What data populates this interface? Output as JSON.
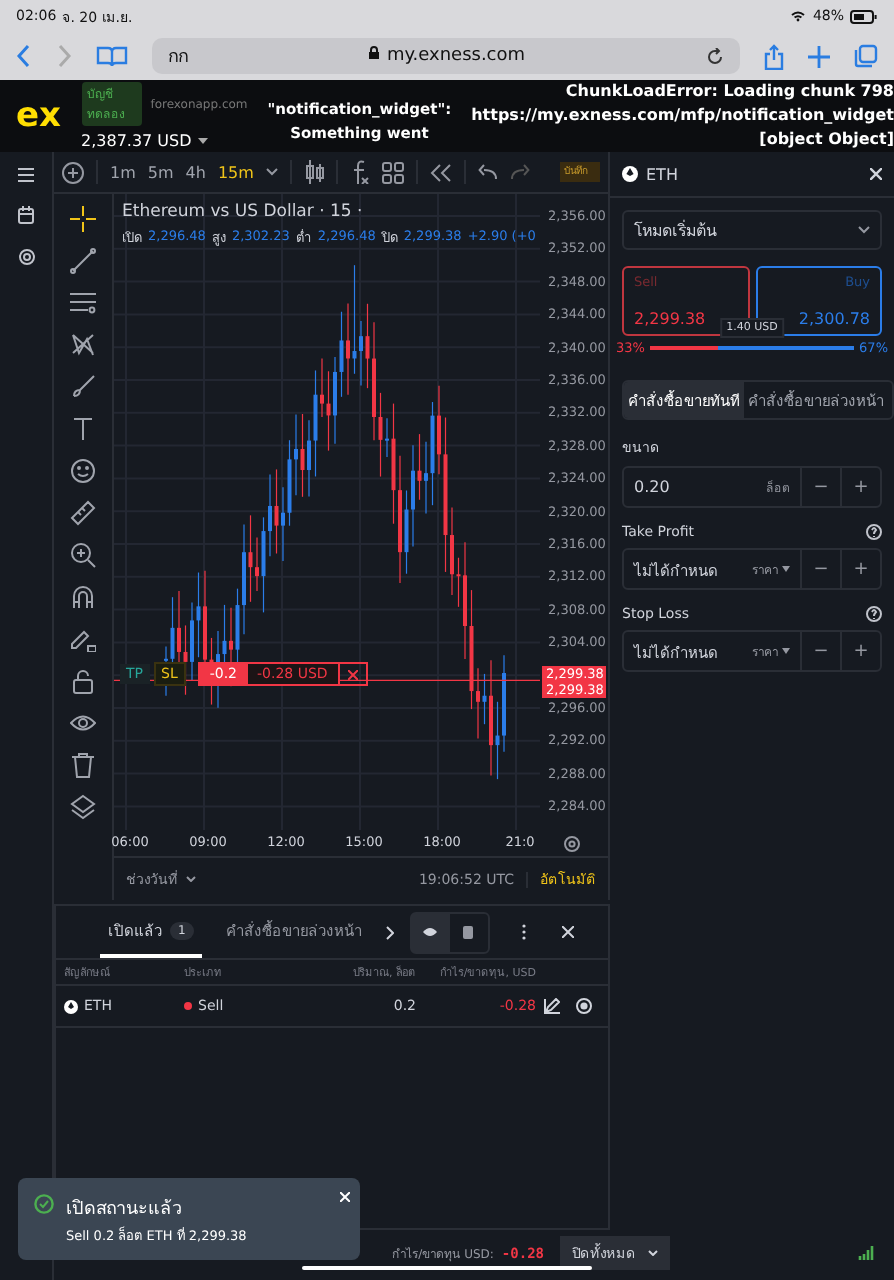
{
  "status_bar": {
    "time": "02:06",
    "date": "จ. 20 เม.ย.",
    "battery": "48%"
  },
  "browser": {
    "tab_text": "กก",
    "url": "my.exness.com"
  },
  "header": {
    "logo": "ex",
    "account_badge": "บัญชีทดลอง",
    "account_server": "forexonapp.com",
    "balance": "2,387.37 USD",
    "error_center": [
      "\"notification_widget\":",
      "Something went"
    ],
    "error_right": [
      "ChunkLoadError: Loading chunk 798",
      "https://my.exness.com/mfp/notification_widget",
      "[object Object]"
    ]
  },
  "chart_toolbar": {
    "timeframes": [
      {
        "label": "1m",
        "selected": false
      },
      {
        "label": "5m",
        "selected": false
      },
      {
        "label": "4h",
        "selected": false
      },
      {
        "label": "15m",
        "selected": true
      }
    ],
    "save_label": "บันทึก"
  },
  "chart": {
    "title": "Ethereum vs US Dollar · 15 ·",
    "ohlc": [
      {
        "label": "เปิด",
        "value": "2,296.48"
      },
      {
        "label": "สูง",
        "value": "2,302.23"
      },
      {
        "label": "ต่ำ",
        "value": "2,296.48"
      },
      {
        "label": "ปิด",
        "value": "2,299.38"
      }
    ],
    "change": "+2.90 (+0",
    "y_labels": [
      "2,356.00",
      "2,352.00",
      "2,348.00",
      "2,344.00",
      "2,340.00",
      "2,336.00",
      "2,332.00",
      "2,328.00",
      "2,324.00",
      "2,320.00",
      "2,316.00",
      "2,312.00",
      "2,308.00",
      "2,304.00",
      "2,296.00",
      "2,292.00",
      "2,288.00",
      "2,284.00"
    ],
    "price_tags": [
      "2,299.38",
      "2,299.38"
    ],
    "x_labels": [
      "06:00",
      "09:00",
      "12:00",
      "15:00",
      "18:00",
      "21:0"
    ],
    "position_line": {
      "tp": "TP",
      "sl": "SL",
      "volume": "-0.2",
      "pnl": "-0.28 USD"
    },
    "date_range": "ช่วงวันที่",
    "clock": "19:06:52 UTC",
    "auto_scale": "อัตโนมัติ"
  },
  "order_panel": {
    "symbol": "ETH",
    "mode": "โหมดเริ่มต้น",
    "sell": {
      "label": "Sell",
      "price": "2,299.38"
    },
    "buy": {
      "label": "Buy",
      "price": "2,300.78"
    },
    "spread": "1.40 USD",
    "sell_pct": "33%",
    "buy_pct": "67%",
    "sell_share": {
      "level": 0.33
    },
    "order_tabs": [
      {
        "label": "คำสั่งซื้อขายทันที",
        "selected": true
      },
      {
        "label": "คำสั่งซื้อขายล่วงหน้า",
        "selected": false
      }
    ],
    "fields": [
      {
        "label": "ขนาด",
        "value": "0.20",
        "unit": "ล็อต",
        "minus": "−",
        "plus": "+",
        "help": false
      },
      {
        "label": "Take Profit",
        "placeholder": "ไม่ได้กำหนด",
        "unit": "ราคา",
        "minus": "−",
        "plus": "+",
        "help": true
      },
      {
        "label": "Stop Loss",
        "placeholder": "ไม่ได้กำหนด",
        "unit": "ราคา",
        "minus": "−",
        "plus": "+",
        "help": true
      }
    ]
  },
  "positions": {
    "tabs": [
      {
        "label": "เปิดแล้ว",
        "count": "1",
        "selected": true
      },
      {
        "label": "คำสั่งซื้อขายล่วงหน้า",
        "selected": false
      }
    ],
    "columns": [
      "สัญลักษณ์",
      "ประเภท",
      "ปริมาณ, ล็อต",
      "กำไร/ขาดทุน, USD"
    ],
    "rows": [
      {
        "symbol": "ETH",
        "type": "Sell",
        "color": "#f23645",
        "volume": "0.2",
        "pnl": "-0.28"
      }
    ]
  },
  "footer": {
    "pnl_label": "กำไร/ขาดทุน USD:",
    "pnl": "-0.28",
    "close_all": "ปิดทั้งหมด"
  },
  "toast": {
    "title": "เปิดสถานะแล้ว",
    "message": "Sell 0.2 ล็อต ETH ที่ 2,299.38"
  }
}
